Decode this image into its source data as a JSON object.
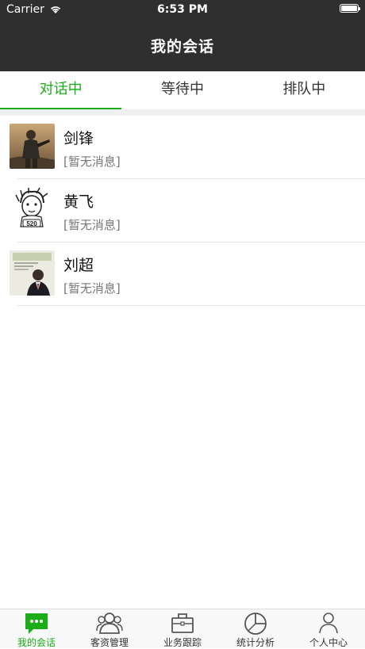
{
  "status_bar": {
    "carrier": "Carrier",
    "time": "6:53 PM"
  },
  "nav": {
    "title": "我的会话"
  },
  "tabs": [
    {
      "label": "对话中",
      "active": true
    },
    {
      "label": "等待中",
      "active": false
    },
    {
      "label": "排队中",
      "active": false
    }
  ],
  "conversations": [
    {
      "name": "剑锋",
      "message": "[暂无消息]",
      "avatar": "soldier-avatar"
    },
    {
      "name": "黄飞",
      "message": "[暂无消息]",
      "avatar": "sketch-avatar"
    },
    {
      "name": "刘超",
      "message": "[暂无消息]",
      "avatar": "magazine-avatar"
    }
  ],
  "tabbar": [
    {
      "label": "我的会话",
      "icon": "chat-bubble-icon",
      "active": true
    },
    {
      "label": "客资管理",
      "icon": "users-icon",
      "active": false
    },
    {
      "label": "业务跟踪",
      "icon": "briefcase-icon",
      "active": false
    },
    {
      "label": "统计分析",
      "icon": "pie-chart-icon",
      "active": false
    },
    {
      "label": "个人中心",
      "icon": "person-icon",
      "active": false
    }
  ],
  "colors": {
    "accent": "#1aad19",
    "header": "#2f2f2f"
  }
}
